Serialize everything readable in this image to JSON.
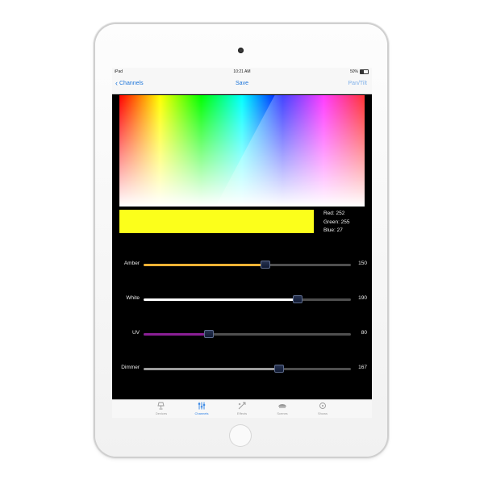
{
  "status_bar": {
    "device": "iPad",
    "time": "10:21 AM",
    "battery": "50%"
  },
  "navbar": {
    "back_label": "Channels",
    "title": "Save",
    "right_label": "Pan/Tilt"
  },
  "color_readout": {
    "red_label": "Red: 252",
    "green_label": "Green: 255",
    "blue_label": "Blue: 27",
    "swatch_color": "#fcff1b"
  },
  "sliders": [
    {
      "label": "Amber",
      "value": "150",
      "fraction": 0.588,
      "fill_color": "#f2b234"
    },
    {
      "label": "White",
      "value": "190",
      "fraction": 0.745,
      "fill_color": "#ffffff"
    },
    {
      "label": "UV",
      "value": "80",
      "fraction": 0.314,
      "fill_color": "#8a1f95"
    },
    {
      "label": "Dimmer",
      "value": "167",
      "fraction": 0.655,
      "fill_color": "#9c9c9c"
    }
  ],
  "tabs": [
    {
      "label": "Devices",
      "icon": "lamp-icon"
    },
    {
      "label": "Channels",
      "icon": "sliders-icon",
      "active": true
    },
    {
      "label": "Effects",
      "icon": "effects-icon"
    },
    {
      "label": "Scenes",
      "icon": "scenes-icon"
    },
    {
      "label": "Shows",
      "icon": "shows-icon"
    }
  ],
  "colors": {
    "accent": "#2a7fe4",
    "screen_bg": "#000000"
  }
}
